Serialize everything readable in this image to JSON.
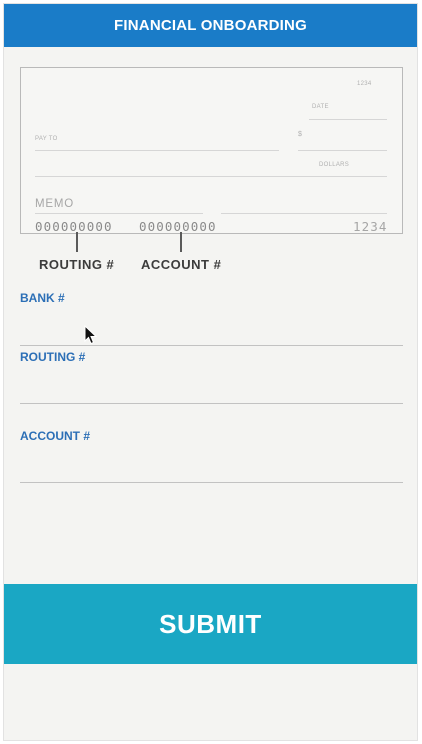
{
  "header": {
    "title": "FINANCIAL ONBOARDING"
  },
  "check": {
    "check_number_top": "1234",
    "date_label": "DATE",
    "pay_to_label": "PAY TO",
    "dollar_sign": "$",
    "dollars_label": "DOLLARS",
    "memo_label": "MEMO",
    "routing_digits": "000000000",
    "account_digits": "000000000",
    "check_number_bottom": "1234",
    "routing_caption": "ROUTING #",
    "account_caption": "ACCOUNT #"
  },
  "form": {
    "bank_label": "BANK #",
    "bank_value": "",
    "routing_label": "ROUTING #",
    "routing_value": "",
    "account_label": "ACCOUNT #",
    "account_value": ""
  },
  "submit": {
    "label": "SUBMIT"
  },
  "colors": {
    "header": "#1a7cc8",
    "submit": "#1aa7c4",
    "label": "#2c6fb6"
  },
  "icons": {
    "cursor": "mouse-pointer-icon"
  }
}
